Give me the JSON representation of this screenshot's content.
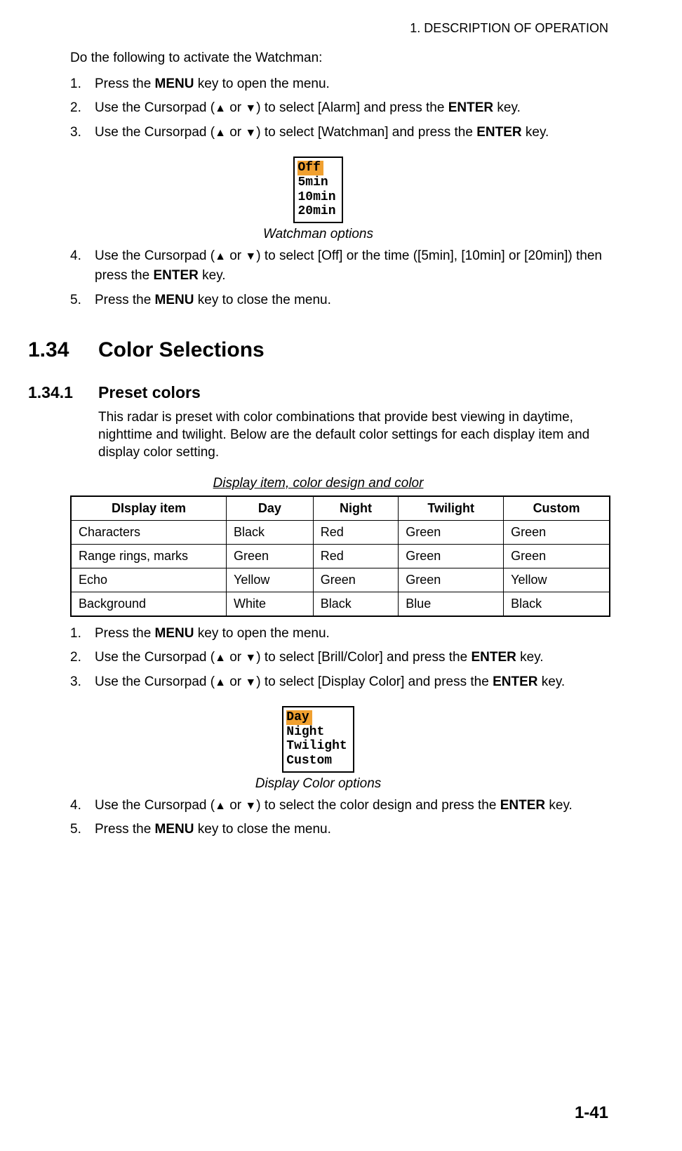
{
  "header": "1.  DESCRIPTION OF OPERATION",
  "intro": "Do the following to activate the Watchman:",
  "steps1": [
    {
      "n": "1.",
      "pre": "Press the ",
      "bold1": "MENU",
      "post": " key to open the menu."
    },
    {
      "n": "2.",
      "pre": "Use the Cursorpad (",
      "mid": ") to select [Alarm] and press the ",
      "bold1": "ENTER",
      "post": " key."
    },
    {
      "n": "3.",
      "pre": "Use the Cursorpad (",
      "mid": ") to select [Watchman] and press the ",
      "bold1": "ENTER",
      "post": " key."
    }
  ],
  "menu1": {
    "sel": "Off",
    "opts": [
      "5min",
      "10min",
      "20min"
    ]
  },
  "caption1": "Watchman options",
  "steps2": [
    {
      "n": "4.",
      "pre": "Use the Cursorpad (",
      "mid": ") to select [Off] or the time ([5min], [10min] or [20min]) then press the ",
      "bold1": "ENTER",
      "post": " key."
    },
    {
      "n": "5.",
      "pre": "Press the ",
      "bold1": "MENU",
      "post": " key to close the menu."
    }
  ],
  "h1": {
    "num": "1.34",
    "title": "Color Selections"
  },
  "h2": {
    "num": "1.34.1",
    "title": "Preset colors"
  },
  "para2": "This radar is preset with color combinations that provide best viewing in daytime, nighttime and twilight. Below are the default color settings for each display item and display color setting.",
  "tableCaption": "Display item, color design and color",
  "table": {
    "headers": [
      "DIsplay item",
      "Day",
      "Night",
      "Twilight",
      "Custom"
    ],
    "rows": [
      [
        "Characters",
        "Black",
        "Red",
        "Green",
        "Green"
      ],
      [
        "Range rings, marks",
        "Green",
        "Red",
        "Green",
        "Green"
      ],
      [
        "Echo",
        "Yellow",
        "Green",
        "Green",
        "Yellow"
      ],
      [
        "Background",
        "White",
        "Black",
        "Blue",
        "Black"
      ]
    ]
  },
  "steps3": [
    {
      "n": "1.",
      "pre": "Press the ",
      "bold1": "MENU",
      "post": " key to open the menu."
    },
    {
      "n": "2.",
      "pre": "Use the Cursorpad (",
      "mid": ") to select [Brill/Color] and press the ",
      "bold1": "ENTER",
      "post": " key."
    },
    {
      "n": "3.",
      "pre": "Use the Cursorpad (",
      "mid": ") to select [Display Color] and press the ",
      "bold1": "ENTER",
      "post": " key."
    }
  ],
  "menu2": {
    "sel": "Day",
    "opts": [
      "Night",
      "Twilight",
      "Custom"
    ]
  },
  "caption2": "Display Color options",
  "steps4": [
    {
      "n": "4.",
      "pre": "Use the Cursorpad (",
      "mid": ") to select the color design and press the ",
      "bold1": "ENTER",
      "post": " key."
    },
    {
      "n": "5.",
      "pre": "Press the ",
      "bold1": "MENU",
      "post": " key to close the menu."
    }
  ],
  "pageNum": "1-41",
  "orText": " or "
}
